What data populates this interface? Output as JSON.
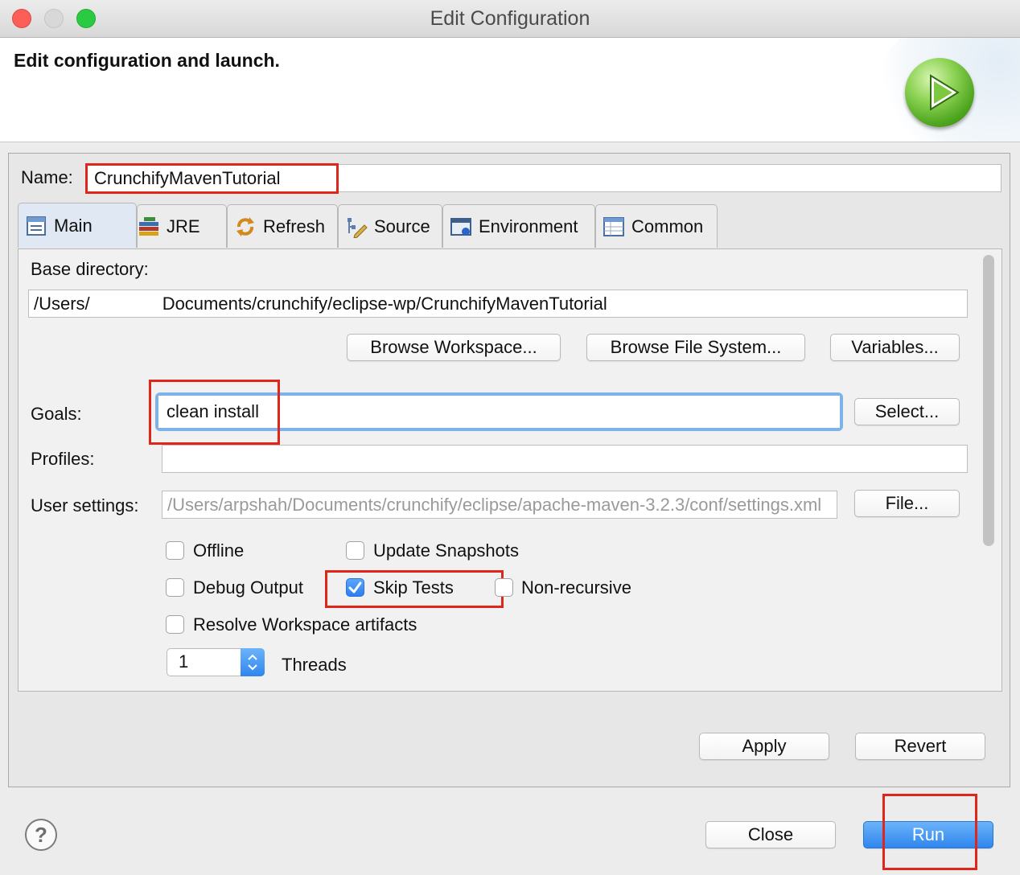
{
  "window": {
    "title": "Edit Configuration"
  },
  "banner": {
    "title": "Edit configuration and launch.",
    "icon": "run-play-icon"
  },
  "name_field": {
    "label": "Name:",
    "value": "CrunchifyMavenTutorial"
  },
  "tabs": [
    {
      "label": "Main",
      "icon": "main-tab-icon",
      "active": true
    },
    {
      "label": "JRE",
      "icon": "jre-icon"
    },
    {
      "label": "Refresh",
      "icon": "refresh-icon"
    },
    {
      "label": "Source",
      "icon": "source-icon"
    },
    {
      "label": "Environment",
      "icon": "environment-icon"
    },
    {
      "label": "Common",
      "icon": "common-icon"
    }
  ],
  "main": {
    "base_directory_label": "Base directory:",
    "base_directory_value": "/Users/",
    "base_directory_value_rest": "Documents/crunchify/eclipse-wp/CrunchifyMavenTutorial",
    "browse_workspace": "Browse Workspace...",
    "browse_file_system": "Browse File System...",
    "variables": "Variables...",
    "goals_label": "Goals:",
    "goals_value": "clean install",
    "select_button": "Select...",
    "profiles_label": "Profiles:",
    "profiles_value": "",
    "user_settings_label": "User settings:",
    "user_settings_value": "/Users/arpshah/Documents/crunchify/eclipse/apache-maven-3.2.3/conf/settings.xml",
    "file_button": "File...",
    "checkboxes": {
      "offline": {
        "label": "Offline",
        "checked": false
      },
      "update_snapshots": {
        "label": "Update Snapshots",
        "checked": false
      },
      "debug_output": {
        "label": "Debug Output",
        "checked": false
      },
      "skip_tests": {
        "label": "Skip Tests",
        "checked": true
      },
      "non_recursive": {
        "label": "Non-recursive",
        "checked": false
      },
      "resolve_workspace": {
        "label": "Resolve Workspace artifacts",
        "checked": false
      }
    },
    "threads_value": "1",
    "threads_label": "Threads"
  },
  "actions": {
    "apply": "Apply",
    "revert": "Revert"
  },
  "footer": {
    "help": "?",
    "close": "Close",
    "run": "Run"
  },
  "colors": {
    "highlight": "#e0261b",
    "accent": "#2f86ee"
  }
}
